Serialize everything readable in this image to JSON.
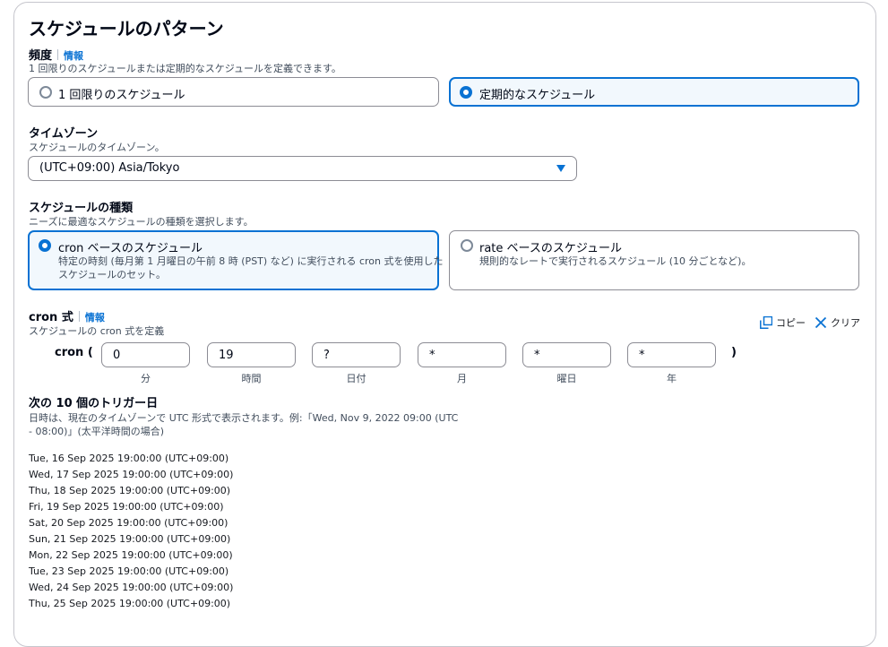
{
  "title": "スケジュールのパターン",
  "frequency": {
    "label": "頻度",
    "info": "情報",
    "description": "1 回限りのスケジュールまたは定期的なスケジュールを定義できます。",
    "options": [
      {
        "label": "1 回限りのスケジュール",
        "selected": false
      },
      {
        "label": "定期的なスケジュール",
        "selected": true
      }
    ]
  },
  "timezone": {
    "label": "タイムゾーン",
    "description": "スケジュールのタイムゾーン。",
    "value": "(UTC+09:00) Asia/Tokyo"
  },
  "schedule_type": {
    "label": "スケジュールの種類",
    "description": "ニーズに最適なスケジュールの種類を選択します。",
    "options": [
      {
        "label": "cron ベースのスケジュール",
        "description_line1": "特定の時刻 (毎月第 1 月曜日の午前 8 時 (PST) など) に実行される cron 式を使用した",
        "description_line2": "スケジュールのセット。",
        "selected": true
      },
      {
        "label": "rate ベースのスケジュール",
        "description_line1": "規則的なレートで実行されるスケジュール (10 分ごとなど)。",
        "description_line2": "",
        "selected": false
      }
    ]
  },
  "cron": {
    "label": "cron 式",
    "info": "情報",
    "description": "スケジュールの cron 式を定義",
    "copy_label": "コピー",
    "clear_label": "クリア",
    "prefix": "cron (",
    "suffix": ")",
    "fields": [
      {
        "value": "0",
        "caption": "分"
      },
      {
        "value": "19",
        "caption": "時間"
      },
      {
        "value": "?",
        "caption": "日付"
      },
      {
        "value": "*",
        "caption": "月"
      },
      {
        "value": "*",
        "caption": "曜日"
      },
      {
        "value": "*",
        "caption": "年"
      }
    ]
  },
  "triggers": {
    "label": "次の 10 個のトリガー日",
    "description_line1": "日時は、現在のタイムゾーンで UTC 形式で表示されます。例:「Wed, Nov 9, 2022 09:00 (UTC",
    "description_line2": "- 08:00)」(太平洋時間の場合)",
    "dates": [
      "Tue, 16 Sep 2025 19:00:00 (UTC+09:00)",
      "Wed, 17 Sep 2025 19:00:00 (UTC+09:00)",
      "Thu, 18 Sep 2025 19:00:00 (UTC+09:00)",
      "Fri, 19 Sep 2025 19:00:00 (UTC+09:00)",
      "Sat, 20 Sep 2025 19:00:00 (UTC+09:00)",
      "Sun, 21 Sep 2025 19:00:00 (UTC+09:00)",
      "Mon, 22 Sep 2025 19:00:00 (UTC+09:00)",
      "Tue, 23 Sep 2025 19:00:00 (UTC+09:00)",
      "Wed, 24 Sep 2025 19:00:00 (UTC+09:00)",
      "Thu, 25 Sep 2025 19:00:00 (UTC+09:00)"
    ]
  },
  "colors": {
    "accent": "#0972d3",
    "selected_bg": "#f2f8fd",
    "border": "#8c8c94"
  }
}
